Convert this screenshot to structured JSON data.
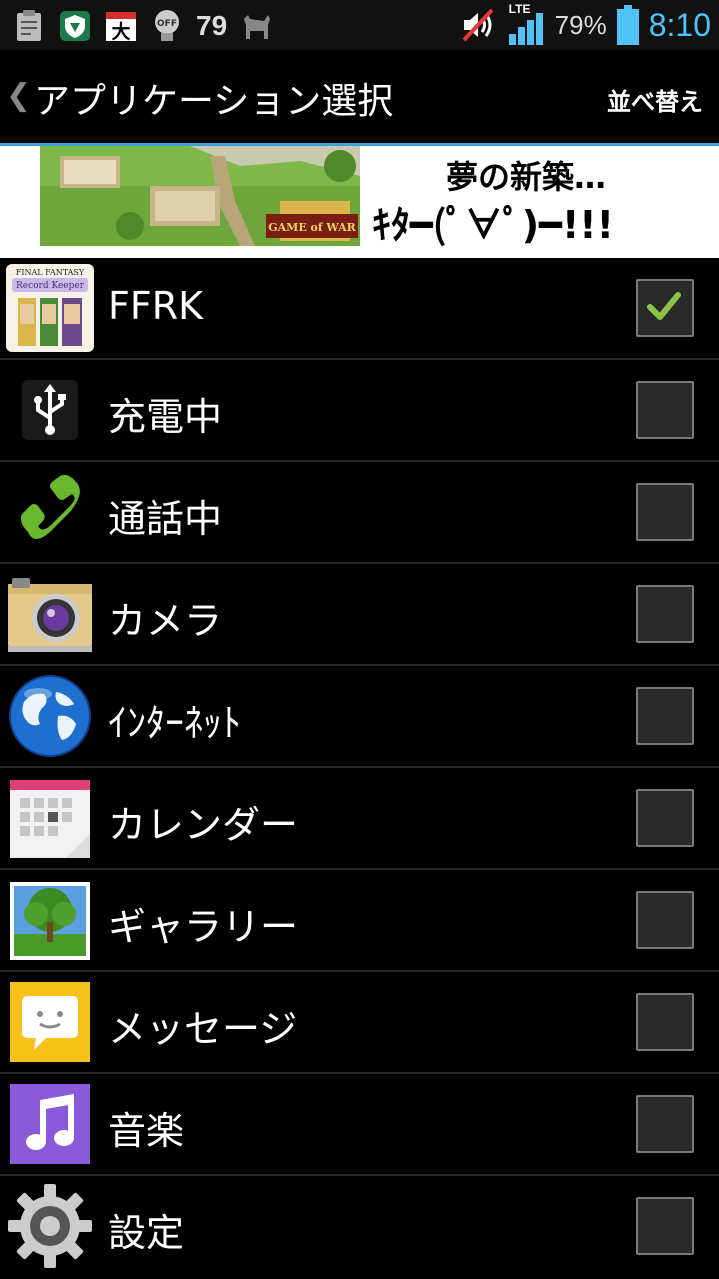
{
  "status_bar": {
    "notification_count": "79",
    "battery_percent": "79%",
    "time": "8:10",
    "network": "LTE",
    "calendar_icon_text": "大",
    "off_badge": "OFF"
  },
  "action_bar": {
    "title": "アプリケーション選択",
    "sort_label": "並べ替え"
  },
  "banner": {
    "line1": "夢の新築…",
    "line2": "ｷﾀ━(ﾟ∀ﾟ)━!!!",
    "game_logo_text": "GAME of WAR"
  },
  "apps": [
    {
      "label": "FFRK",
      "checked": true,
      "icon": "ffrk-icon"
    },
    {
      "label": "充電中",
      "checked": false,
      "icon": "usb-icon"
    },
    {
      "label": "通話中",
      "checked": false,
      "icon": "phone-icon"
    },
    {
      "label": "カメラ",
      "checked": false,
      "icon": "camera-icon"
    },
    {
      "label": "ｲﾝﾀｰﾈｯﾄ",
      "checked": false,
      "icon": "globe-icon"
    },
    {
      "label": "カレンダー",
      "checked": false,
      "icon": "calendar-icon"
    },
    {
      "label": "ギャラリー",
      "checked": false,
      "icon": "gallery-icon"
    },
    {
      "label": "メッセージ",
      "checked": false,
      "icon": "message-icon"
    },
    {
      "label": "音楽",
      "checked": false,
      "icon": "music-icon"
    },
    {
      "label": "設定",
      "checked": false,
      "icon": "settings-icon"
    }
  ],
  "colors": {
    "accent": "#3aa0d8",
    "time": "#4fc3f7",
    "check": "#8bc34a"
  }
}
